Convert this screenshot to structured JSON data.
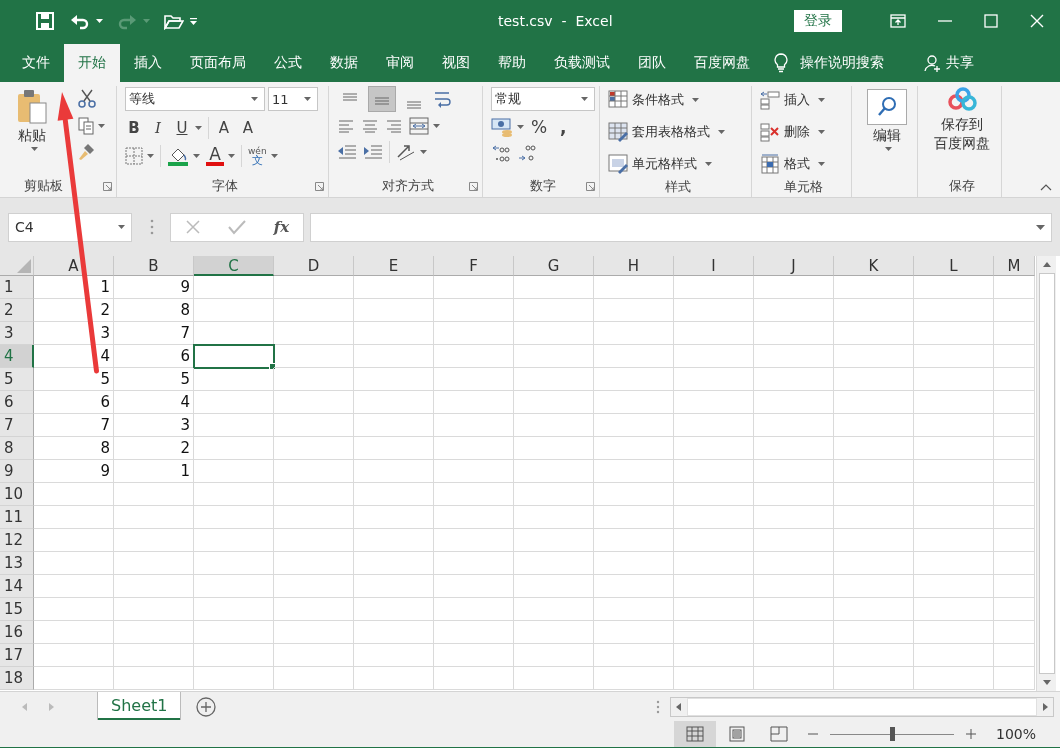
{
  "window": {
    "title": "test.csv  -  Excel",
    "sign_in": "登录"
  },
  "quick_access": [
    {
      "kind": "save",
      "disabled": false
    },
    {
      "kind": "undo",
      "disabled": false
    },
    {
      "kind": "redo",
      "disabled": true
    },
    {
      "kind": "open",
      "disabled": false
    }
  ],
  "tabs": [
    {
      "label": "文件",
      "selected": false
    },
    {
      "label": "开始",
      "selected": true
    },
    {
      "label": "插入",
      "selected": false
    },
    {
      "label": "页面布局",
      "selected": false
    },
    {
      "label": "公式",
      "selected": false
    },
    {
      "label": "数据",
      "selected": false
    },
    {
      "label": "审阅",
      "selected": false
    },
    {
      "label": "视图",
      "selected": false
    },
    {
      "label": "帮助",
      "selected": false
    },
    {
      "label": "负载测试",
      "selected": false
    },
    {
      "label": "团队",
      "selected": false
    },
    {
      "label": "百度网盘",
      "selected": false
    }
  ],
  "tell_me": "操作说明搜索",
  "share": "共享",
  "ribbon": {
    "clipboard": {
      "paste": "粘贴",
      "label": "剪贴板"
    },
    "font": {
      "font_name": "等线",
      "font_size": "11",
      "bold": "B",
      "italic": "I",
      "underline": "U",
      "grow": "A",
      "shrink": "A",
      "font_color": "A",
      "phonetic": [
        "wén",
        "文"
      ],
      "label": "字体"
    },
    "alignment": {
      "buttons": [
        {
          "kind": "top",
          "selected": false
        },
        {
          "kind": "middle",
          "selected": true
        },
        {
          "kind": "bottom",
          "selected": false
        }
      ],
      "label": "对齐方式"
    },
    "number": {
      "format": "常规",
      "percent": "%",
      "comma": ",",
      "label": "数字"
    },
    "styles": {
      "items": [
        "条件格式",
        "套用表格格式",
        "单元格样式"
      ],
      "label": "样式"
    },
    "cells": {
      "items": [
        "插入",
        "删除",
        "格式"
      ],
      "label": "单元格"
    },
    "editing": {
      "label": "编辑"
    },
    "save": {
      "lines": [
        "保存到",
        "百度网盘"
      ],
      "label": "保存"
    }
  },
  "formula_bar": {
    "name_box": "C4",
    "fx": "fx"
  },
  "grid": {
    "columns": [
      {
        "label": "A",
        "selected": false
      },
      {
        "label": "B",
        "selected": false
      },
      {
        "label": "C",
        "selected": true
      },
      {
        "label": "D",
        "selected": false
      },
      {
        "label": "E",
        "selected": false
      },
      {
        "label": "F",
        "selected": false
      },
      {
        "label": "G",
        "selected": false
      },
      {
        "label": "H",
        "selected": false
      },
      {
        "label": "I",
        "selected": false
      },
      {
        "label": "J",
        "selected": false
      },
      {
        "label": "K",
        "selected": false
      },
      {
        "label": "L",
        "selected": false
      },
      {
        "label": "M",
        "selected": false
      }
    ],
    "rows": [
      {
        "label": "1",
        "selected": false,
        "cells": [
          "1",
          "9"
        ]
      },
      {
        "label": "2",
        "selected": false,
        "cells": [
          "2",
          "8"
        ]
      },
      {
        "label": "3",
        "selected": false,
        "cells": [
          "3",
          "7"
        ]
      },
      {
        "label": "4",
        "selected": true,
        "cells": [
          "4",
          "6"
        ]
      },
      {
        "label": "5",
        "selected": false,
        "cells": [
          "5",
          "5"
        ]
      },
      {
        "label": "6",
        "selected": false,
        "cells": [
          "6",
          "4"
        ]
      },
      {
        "label": "7",
        "selected": false,
        "cells": [
          "7",
          "3"
        ]
      },
      {
        "label": "8",
        "selected": false,
        "cells": [
          "8",
          "2"
        ]
      },
      {
        "label": "9",
        "selected": false,
        "cells": [
          "9",
          "1"
        ]
      },
      {
        "label": "10",
        "selected": false,
        "cells": []
      },
      {
        "label": "11",
        "selected": false,
        "cells": []
      },
      {
        "label": "12",
        "selected": false,
        "cells": []
      },
      {
        "label": "13",
        "selected": false,
        "cells": []
      },
      {
        "label": "14",
        "selected": false,
        "cells": []
      },
      {
        "label": "15",
        "selected": false,
        "cells": []
      },
      {
        "label": "16",
        "selected": false,
        "cells": []
      },
      {
        "label": "17",
        "selected": false,
        "cells": []
      },
      {
        "label": "18",
        "selected": false,
        "cells": []
      }
    ]
  },
  "sheets": [
    {
      "name": "Sheet1",
      "selected": true
    }
  ],
  "status_bar": {
    "views": [
      {
        "kind": "normal",
        "selected": true
      },
      {
        "kind": "page_layout",
        "selected": false
      },
      {
        "kind": "page_break",
        "selected": false
      }
    ],
    "zoom": {
      "level": 0.5,
      "reading": "100%"
    }
  }
}
